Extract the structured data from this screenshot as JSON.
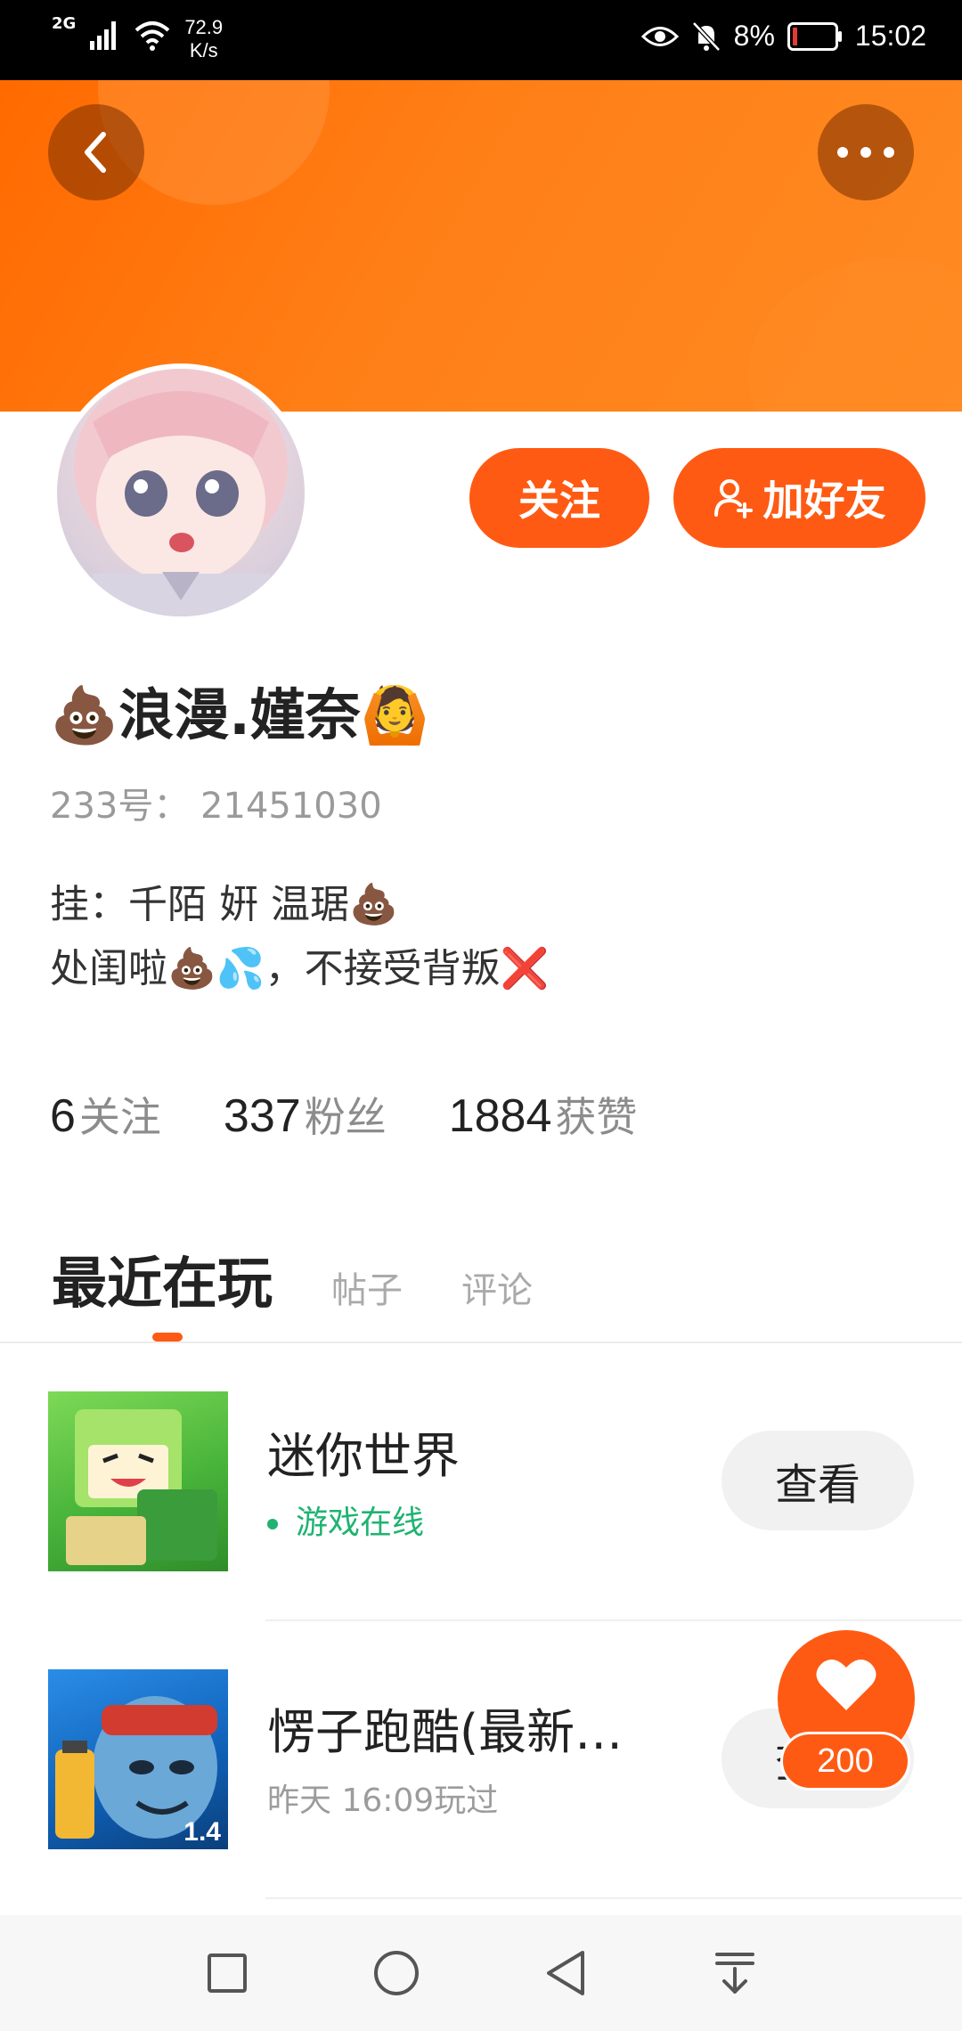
{
  "status_bar": {
    "network": "2G",
    "speed_value": "72.9",
    "speed_unit": "K/s",
    "battery": "8%",
    "time": "15:02"
  },
  "profile": {
    "name": "💩浪漫.嫤奈🙆",
    "uid": "233号： 21451030",
    "bio_line1": "挂：千陌 姸 温琚💩",
    "bio_line2": "处闺啦💩💦，不接受背叛❌",
    "follow_label": "关注",
    "add_friend_label": "加好友"
  },
  "stats": [
    {
      "num": "6",
      "label": "关注"
    },
    {
      "num": "337",
      "label": "粉丝"
    },
    {
      "num": "1884",
      "label": "获赞"
    }
  ],
  "tabs": [
    {
      "label": "最近在玩",
      "active": true
    },
    {
      "label": "帖子",
      "active": false
    },
    {
      "label": "评论",
      "active": false
    }
  ],
  "games": [
    {
      "title": "迷你世界",
      "status": "游戏在线",
      "button": "查看",
      "thumb_icon": "mini-world-thumbnail"
    },
    {
      "title": "愣子跑酷(最新…",
      "status": "昨天 16:09玩过",
      "button": "查看",
      "thumb_icon": "runner-thumbnail",
      "thumb_badge": "1.4"
    }
  ],
  "like": {
    "count": "200"
  },
  "colors": {
    "accent": "#ff5a13",
    "online": "#1fb371"
  }
}
